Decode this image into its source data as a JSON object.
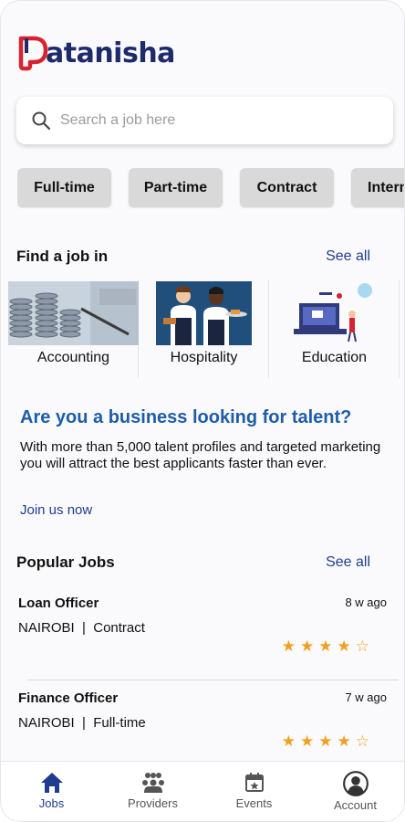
{
  "app": {
    "logo_text": "atanisha"
  },
  "search": {
    "placeholder": "Search a job here"
  },
  "job_types": [
    "Full-time",
    "Part-time",
    "Contract",
    "Intern"
  ],
  "find_job": {
    "title": "Find a job in",
    "see_all": "See all",
    "categories": [
      "Accounting",
      "Hospitality",
      "Education"
    ]
  },
  "promo": {
    "title": "Are you a business looking for talent?",
    "text": "With more than 5,000 talent profiles and targeted marketing you will attract the best applicants faster than ever.",
    "link": "Join us now"
  },
  "popular": {
    "title": "Popular Jobs",
    "see_all": "See all",
    "jobs": [
      {
        "title": "Loan Officer",
        "ago": "8 w ago",
        "meta": "NAIROBI  |  Contract",
        "stars": "★★★★☆",
        "rating": 4
      },
      {
        "title": "Finance Officer",
        "ago": "7 w ago",
        "meta": "NAIROBI  |  Full-time",
        "stars": "★★★★☆",
        "rating": 4
      }
    ]
  },
  "tabs": [
    {
      "label": "Jobs",
      "icon": "home-icon",
      "active": true
    },
    {
      "label": "Providers",
      "icon": "providers-icon"
    },
    {
      "label": "Events",
      "icon": "calendar-icon"
    },
    {
      "label": "Account",
      "icon": "account-icon"
    }
  ],
  "colors": {
    "brand_navy": "#1d2a6b",
    "brand_red": "#d8232f",
    "link_blue": "#1f3c8f",
    "promo_blue": "#1e5da8",
    "star": "#f0a01e",
    "chip_bg": "#d9d9d9"
  }
}
